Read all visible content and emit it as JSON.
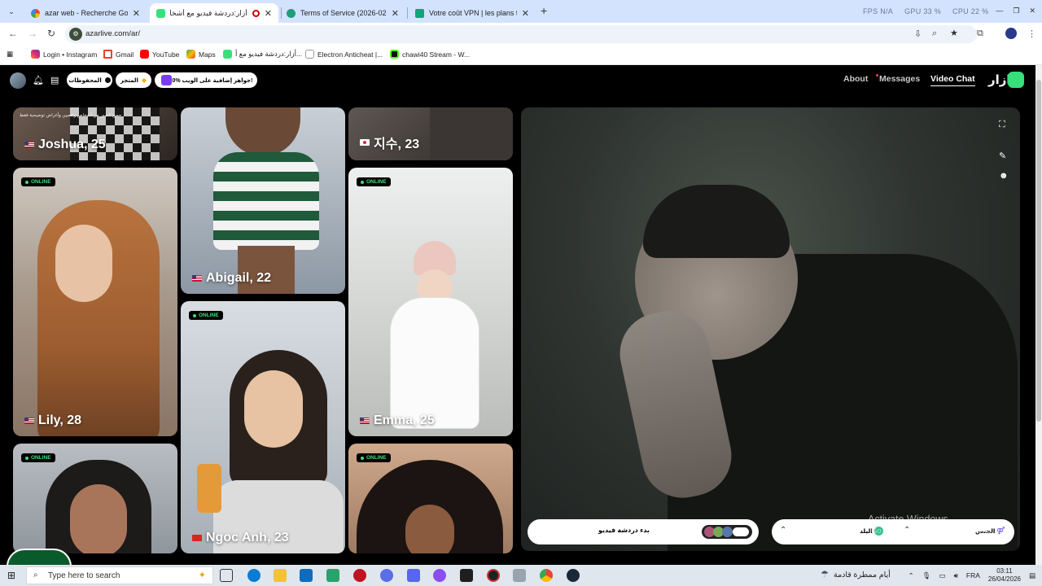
{
  "browser": {
    "tabs": [
      {
        "title": "azar web - Recherche Google",
        "active": false
      },
      {
        "title": "أزار:دردشة فيديو مع أشخاص",
        "active": true
      },
      {
        "title": "Terms of Service (2026-02-01)",
        "active": false
      },
      {
        "title": "Votre coût VPN | les plans tarifs",
        "active": false
      }
    ],
    "sys_stats": {
      "fps": "FPS N/A",
      "gpu": "GPU 33 %",
      "cpu": "CPU 22 %"
    },
    "url": "azarlive.com/ar/",
    "bookmarks": [
      "Login • Instagram",
      "Gmail",
      "YouTube",
      "Maps",
      "أزار:دردشة فيديو مع أ...",
      "Electron Anticheat |...",
      "chawi40 Stream - W..."
    ]
  },
  "site": {
    "header": {
      "saved_label": "المحفوظات",
      "store_label": "المتجر",
      "promo_label": "10% جواهر إضافية على الويب!",
      "nav": {
        "about": "About",
        "messages": "Messages",
        "video_chat": "Video Chat"
      },
      "brand": "ازار"
    },
    "cards": [
      {
        "name": "Joshua, 25",
        "caption": "جميع الصور من أشخاص واقعيين وأغراض توضيحية فقط",
        "flag": "us",
        "online": false
      },
      {
        "name": "지수, 23",
        "flag": "kr",
        "online": false
      },
      {
        "name": "Abigail, 22",
        "flag": "us",
        "online": false
      },
      {
        "name": "Lily, 28",
        "flag": "us",
        "online": true
      },
      {
        "name": "Emma, 25",
        "flag": "us",
        "online": true
      },
      {
        "name": "",
        "flag": "",
        "online": true
      },
      {
        "name": "Ngoc Anh, 23",
        "flag": "vn",
        "online": true
      },
      {
        "name": "",
        "flag": "",
        "online": true
      }
    ],
    "online_label": "ONLINE",
    "start_button": "بدء دردشة فيديو",
    "filter": {
      "gender": "الجنس",
      "region": "البلد"
    },
    "watermark": {
      "line1": "Activate Windows",
      "line2": "Go to Settings to activate Windows."
    }
  },
  "taskbar": {
    "search_placeholder": "Type here to search",
    "weather_text": "أيام ممطرة قادمة",
    "language": "FRA",
    "time": "03:11",
    "date": "26/04/2026"
  },
  "colors": {
    "brand_green": "#36e07a",
    "online_green": "#3ee07a",
    "tab_strip": "#d3e3fd"
  }
}
